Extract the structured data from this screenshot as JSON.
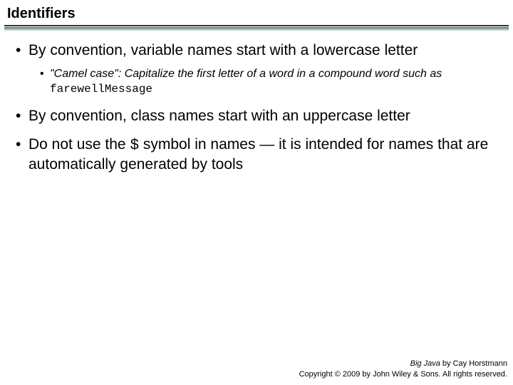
{
  "title": "Identifiers",
  "bullets": {
    "b1": "By convention, variable names start with a lowercase letter",
    "b1_sub_pre": "\"Camel case\": Capitalize the first letter of a word in a compound word such as ",
    "b1_sub_code": "farewellMessage",
    "b2": "By convention, class names start with an uppercase letter",
    "b3_pre": "Do not use the ",
    "b3_code": "$",
    "b3_post": " symbol in names — it is intended for names that are automatically generated by tools"
  },
  "footer": {
    "book": "Big Java",
    "byline": " by Cay Horstmann",
    "copyright": "Copyright © 2009 by John Wiley & Sons.  All rights reserved."
  }
}
